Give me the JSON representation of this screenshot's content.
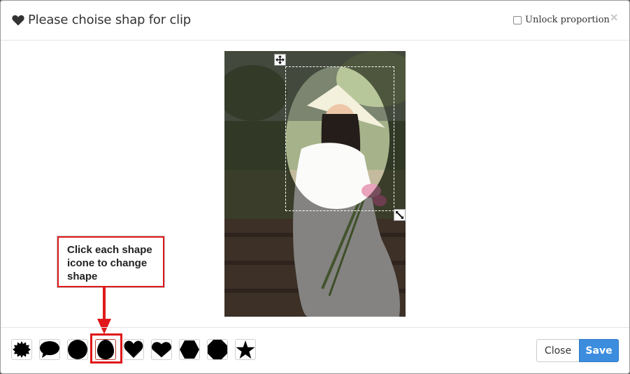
{
  "dialog": {
    "title": "Please choise shap for clip",
    "unlock_label": "Unlock proportion",
    "unlock_checked": false,
    "close_symbol": "×"
  },
  "annotation": {
    "text": "Click each shape icone to change shape",
    "border_color": "#e0181b"
  },
  "shapes": [
    {
      "name": "starburst",
      "selected": false
    },
    {
      "name": "speech-bubble",
      "selected": false
    },
    {
      "name": "circle",
      "selected": false
    },
    {
      "name": "egg",
      "selected": true
    },
    {
      "name": "heart",
      "selected": false
    },
    {
      "name": "wide-heart",
      "selected": false
    },
    {
      "name": "hexagon",
      "selected": false
    },
    {
      "name": "octagon",
      "selected": false
    },
    {
      "name": "star",
      "selected": false
    }
  ],
  "footer": {
    "close_label": "Close",
    "save_label": "Save"
  },
  "colors": {
    "accent": "#3c8dde",
    "annotation": "#e0181b"
  }
}
